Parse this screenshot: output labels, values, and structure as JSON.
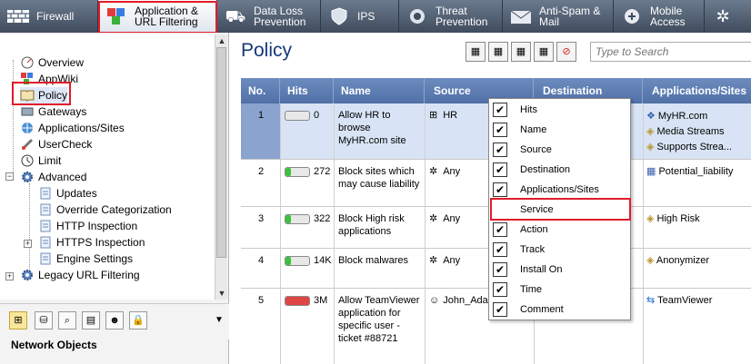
{
  "tabs": [
    {
      "label": "Firewall",
      "icon": "brick-wall-icon"
    },
    {
      "label": "Application & URL Filtering",
      "icon": "app-cubes-icon"
    },
    {
      "label": "Data Loss Prevention",
      "icon": "dlp-icon"
    },
    {
      "label": "IPS",
      "icon": "shield-icon"
    },
    {
      "label": "Threat Prevention",
      "icon": "threat-icon"
    },
    {
      "label": "Anti-Spam & Mail",
      "icon": "mail-icon"
    },
    {
      "label": "Mobile Access",
      "icon": "mobile-icon"
    }
  ],
  "tree": {
    "items": [
      {
        "label": "Overview"
      },
      {
        "label": "AppWiki"
      },
      {
        "label": "Policy"
      },
      {
        "label": "Gateways"
      },
      {
        "label": "Applications/Sites"
      },
      {
        "label": "UserCheck"
      },
      {
        "label": "Limit"
      },
      {
        "label": "Advanced"
      },
      {
        "label": "Updates"
      },
      {
        "label": "Override Categorization"
      },
      {
        "label": "HTTP Inspection"
      },
      {
        "label": "HTTPS Inspection"
      },
      {
        "label": "Engine Settings"
      },
      {
        "label": "Legacy URL Filtering"
      }
    ]
  },
  "network_objects_label": "Network Objects",
  "main": {
    "title": "Policy",
    "search_placeholder": "Type to Search",
    "columns": [
      "No.",
      "Hits",
      "Name",
      "Source",
      "Destination",
      "Applications/Sites"
    ],
    "rows": [
      {
        "no": "1",
        "hits": "0",
        "hits_level": 0,
        "name": "Allow HR to browse MyHR.com site",
        "source": "HR",
        "apps": [
          "MyHR.com",
          "Media Streams",
          "Supports Strea..."
        ]
      },
      {
        "no": "2",
        "hits": "272",
        "hits_level": 0.2,
        "name": "Block sites which may cause liability",
        "source": "Any",
        "apps": [
          "Potential_liability"
        ]
      },
      {
        "no": "3",
        "hits": "322",
        "hits_level": 0.2,
        "name": "Block High risk applications",
        "source": "Any",
        "apps": [
          "High Risk"
        ]
      },
      {
        "no": "4",
        "hits": "14K",
        "hits_level": 0.2,
        "name": "Block malwares",
        "source": "Any",
        "apps": [
          "Anonymizer"
        ]
      },
      {
        "no": "5",
        "hits": "3M",
        "hits_level": 1,
        "name": "Allow TeamViewer application for specific user - ticket #88721",
        "source": "John_Ada",
        "apps": [
          "TeamViewer"
        ]
      }
    ]
  },
  "column_menu": {
    "items": [
      {
        "label": "Hits",
        "checked": true
      },
      {
        "label": "Name",
        "checked": true
      },
      {
        "label": "Source",
        "checked": true
      },
      {
        "label": "Destination",
        "checked": true
      },
      {
        "label": "Applications/Sites",
        "checked": true
      },
      {
        "label": "Service",
        "checked": false
      },
      {
        "label": "Action",
        "checked": true
      },
      {
        "label": "Track",
        "checked": true
      },
      {
        "label": "Install On",
        "checked": true
      },
      {
        "label": "Time",
        "checked": true
      },
      {
        "label": "Comment",
        "checked": true
      }
    ]
  },
  "colors": {
    "highlight": "#e01c2a",
    "header": "#5a7ab2",
    "hits_green": "#3cc13c",
    "hits_red": "#e04545"
  }
}
